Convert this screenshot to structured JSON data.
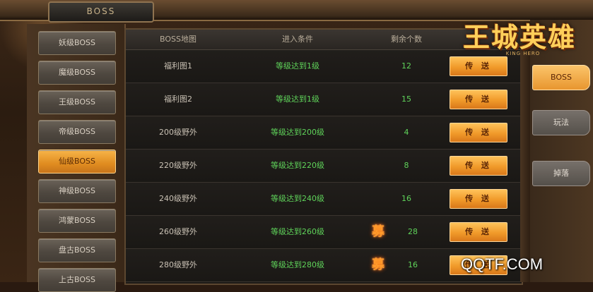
{
  "header": {
    "boss_tab": "BOSS"
  },
  "logo": {
    "title": "王城英雄",
    "subtitle": "KING HERO"
  },
  "sidebar": {
    "items": [
      {
        "label": "妖级BOSS",
        "active": false
      },
      {
        "label": "魔级BOSS",
        "active": false
      },
      {
        "label": "王级BOSS",
        "active": false
      },
      {
        "label": "帝级BOSS",
        "active": false
      },
      {
        "label": "仙级BOSS",
        "active": true
      },
      {
        "label": "神级BOSS",
        "active": false
      },
      {
        "label": "鸿蒙BOSS",
        "active": false
      },
      {
        "label": "盘古BOSS",
        "active": false
      },
      {
        "label": "上古BOSS",
        "active": false
      }
    ]
  },
  "table": {
    "headers": {
      "map": "BOSS地图",
      "condition": "进入条件",
      "remaining": "剩余个数"
    },
    "button_label": "传 送",
    "rows": [
      {
        "map": "福利图1",
        "condition": "等级达到1级",
        "remaining": "12",
        "recruit": ""
      },
      {
        "map": "福利图2",
        "condition": "等级达到1级",
        "remaining": "15",
        "recruit": ""
      },
      {
        "map": "200级野外",
        "condition": "等级达到200级",
        "remaining": "4",
        "recruit": ""
      },
      {
        "map": "220级野外",
        "condition": "等级达到220级",
        "remaining": "8",
        "recruit": ""
      },
      {
        "map": "240级野外",
        "condition": "等级达到240级",
        "remaining": "16",
        "recruit": ""
      },
      {
        "map": "260级野外",
        "condition": "等级达到260级",
        "remaining": "28",
        "recruit": "募"
      },
      {
        "map": "280级野外",
        "condition": "等级达到280级",
        "remaining": "16",
        "recruit": "募"
      }
    ]
  },
  "right_tabs": [
    {
      "label": "BOSS",
      "active": true
    },
    {
      "label": "玩法",
      "active": false
    },
    {
      "label": "掉落",
      "active": false
    }
  ],
  "watermark": "QQTF.COM"
}
